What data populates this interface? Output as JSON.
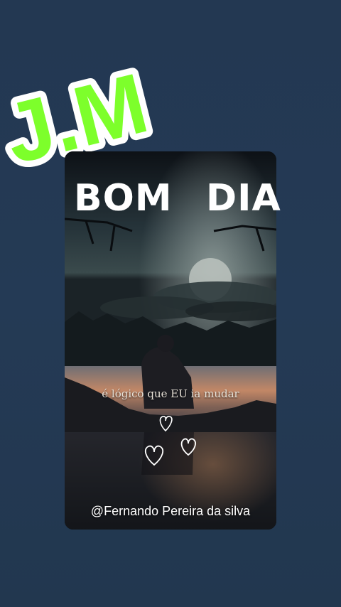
{
  "logo": {
    "text": "J.M",
    "fill_color": "#7dff2b",
    "outline_color": "#ffffff"
  },
  "card": {
    "title_word_1": "BOM",
    "title_word_2": "DIA",
    "caption": "é lógico que EU ia mudar",
    "handle": "@Fernando Pereira da silva",
    "icons": [
      "heart-icon",
      "heart-icon",
      "heart-icon"
    ]
  }
}
